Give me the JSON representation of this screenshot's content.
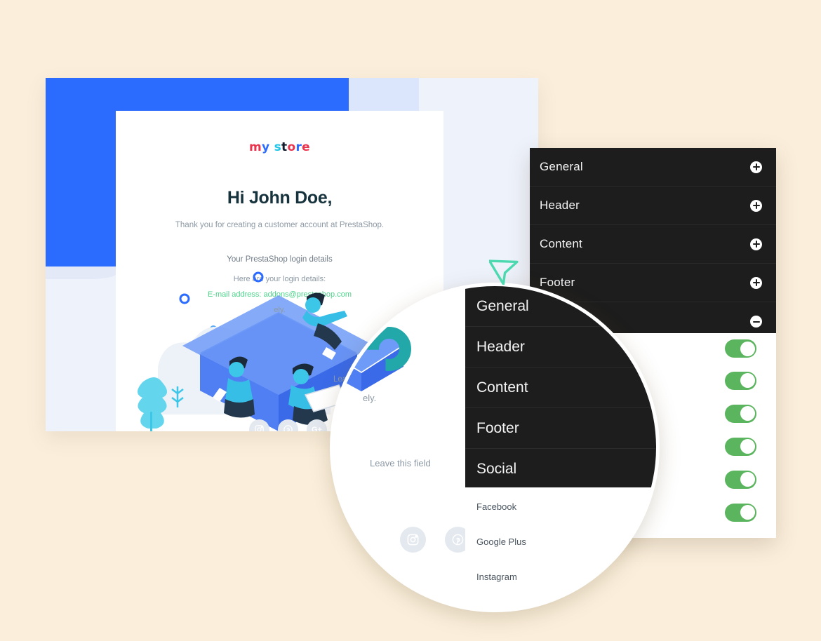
{
  "background_color": "#FBEFDC",
  "email_preview": {
    "brand_logo": {
      "text": "my store",
      "letters": [
        {
          "ch": "m",
          "color": "#E8344E"
        },
        {
          "ch": "y",
          "color": "#2B6BFD"
        },
        {
          "ch": "s",
          "color": "#20C5E8"
        },
        {
          "ch": "t",
          "color": "#111B2B"
        },
        {
          "ch": "o",
          "color": "#E8344E"
        },
        {
          "ch": "r",
          "color": "#2B6BFD"
        },
        {
          "ch": "e",
          "color": "#E8344E"
        }
      ]
    },
    "greeting": "Hi John Doe,",
    "thanks_line": "Thank you for creating a customer account at PrestaShop.",
    "login_title": "Your PrestaShop login details",
    "login_subtitle": "Here are your login details:",
    "login_email": "E-mail address: addons@prestashop.com",
    "login_email_color": "#4CD48A",
    "closing_line": "ely.",
    "leave_field_text": "Leave this field",
    "header_band_color": "#2B6BFD",
    "social_icons": [
      {
        "name": "instagram-icon",
        "glyph": "▢"
      },
      {
        "name": "pinterest-icon",
        "glyph": "P"
      },
      {
        "name": "google-plus-icon",
        "glyph": "G+"
      }
    ]
  },
  "menu_panel": {
    "background_color": "#1D1D1D",
    "items": [
      {
        "label": "General",
        "state_icon": "plus-icon"
      },
      {
        "label": "Header",
        "state_icon": "plus-icon"
      },
      {
        "label": "Content",
        "state_icon": "plus-icon"
      },
      {
        "label": "Footer",
        "state_icon": "plus-icon"
      },
      {
        "label": "",
        "state_icon": "minus-icon"
      }
    ]
  },
  "toggles_panel": {
    "background_color": "#FFFFFF",
    "switch_on_color": "#5BB55E",
    "switches": [
      {
        "name": "toggle-1",
        "state": "on"
      },
      {
        "name": "toggle-2",
        "state": "on"
      },
      {
        "name": "toggle-3",
        "state": "on"
      },
      {
        "name": "toggle-4",
        "state": "on"
      },
      {
        "name": "toggle-5",
        "state": "on"
      },
      {
        "name": "toggle-6",
        "state": "on"
      }
    ]
  },
  "magnifier": {
    "menu_items": [
      {
        "label": "General"
      },
      {
        "label": "Header"
      },
      {
        "label": "Content"
      },
      {
        "label": "Footer"
      },
      {
        "label": "Social"
      }
    ],
    "list_items": [
      {
        "label": "Facebook"
      },
      {
        "label": "Google Plus"
      },
      {
        "label": "Instagram"
      }
    ],
    "leave_field_text": "Leave this field",
    "closing_fragment": "ely.",
    "ring_color": "#23A8AA",
    "social_icons": [
      {
        "name": "instagram-icon",
        "glyph": "▢"
      },
      {
        "name": "pinterest-icon",
        "glyph": "P"
      },
      {
        "name": "google-plus-icon",
        "glyph": "G+"
      }
    ]
  },
  "cursor": {
    "name": "pointer-arrow",
    "color": "#4CD9B0"
  }
}
